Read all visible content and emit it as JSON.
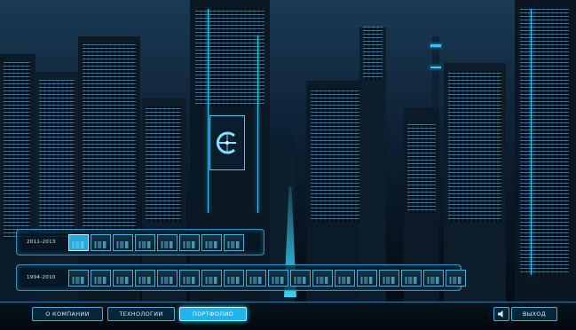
{
  "app": {
    "logo_icon": "company-logo-icon"
  },
  "colors": {
    "accent": "#2ec7ff",
    "active": "#1fb4ee",
    "background": "#0a1826"
  },
  "timeline": {
    "rows": [
      {
        "label": "2011-2013",
        "thumb_count": 8,
        "active_index": 0
      },
      {
        "label": "1994-2010",
        "thumb_count": 18,
        "active_index": -1
      }
    ]
  },
  "nav": {
    "about": "О КОМПАНИИ",
    "technologies": "ТЕХНОЛОГИИ",
    "portfolio": "ПОРТФОЛИО",
    "exit": "ВЫХОД",
    "active": "portfolio"
  },
  "icons": {
    "sound": "speaker-icon"
  }
}
